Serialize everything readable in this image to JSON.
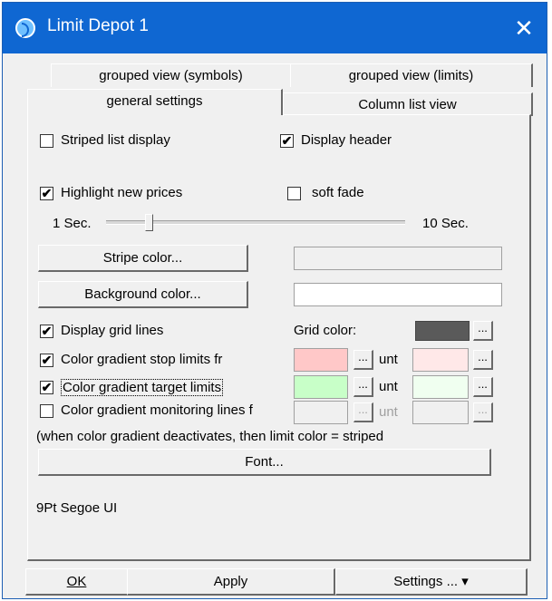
{
  "window": {
    "title": "Limit Depot 1",
    "close_symbol": "✕"
  },
  "tabs": {
    "row1": [
      "grouped view (symbols)",
      "grouped view (limits)"
    ],
    "row2": [
      "general settings",
      "Column list view"
    ]
  },
  "options": {
    "striped_list_display": {
      "label": "Striped list display",
      "checked": false
    },
    "display_header": {
      "label": "Display header",
      "checked": true
    },
    "highlight_new_prices": {
      "label": "Highlight new prices",
      "checked": true
    },
    "soft_fade": {
      "label": "soft fade",
      "checked": false
    }
  },
  "slider": {
    "min_label": "1 Sec.",
    "max_label": "10 Sec.",
    "value_fraction": 0.14
  },
  "buttons": {
    "stripe_color": "Stripe color...",
    "background_color": "Background color...",
    "font": "Font..."
  },
  "colors": {
    "stripe": "#f0f0f0",
    "background": "#ffffff",
    "grid": "#5a5a5a",
    "stop_from": "#ffc8c8",
    "stop_to": "#ffe8e8",
    "target_from": "#c8ffc8",
    "target_to": "#f0fff0",
    "monitor_from": "#f0f0f0",
    "monitor_to": "#f0f0f0"
  },
  "grid": {
    "display_grid_lines": {
      "label": "Display grid lines",
      "checked": true
    },
    "grid_color_label": "Grid color:"
  },
  "gradients": {
    "stop_limits": {
      "label": "Color gradient stop limits fr",
      "checked": true
    },
    "target_limits": {
      "label": "Color gradient target limits",
      "checked": true
    },
    "monitoring_lines": {
      "label": "Color gradient monitoring lines f",
      "checked": false
    },
    "unt_label": "unt",
    "ellipsis": "..."
  },
  "note": "(when color gradient deactivates, then limit color = striped",
  "font_info": "9Pt Segoe UI",
  "bottom_buttons": {
    "ok": "OK",
    "apply": "Apply",
    "settings": "Settings ... ▾"
  }
}
